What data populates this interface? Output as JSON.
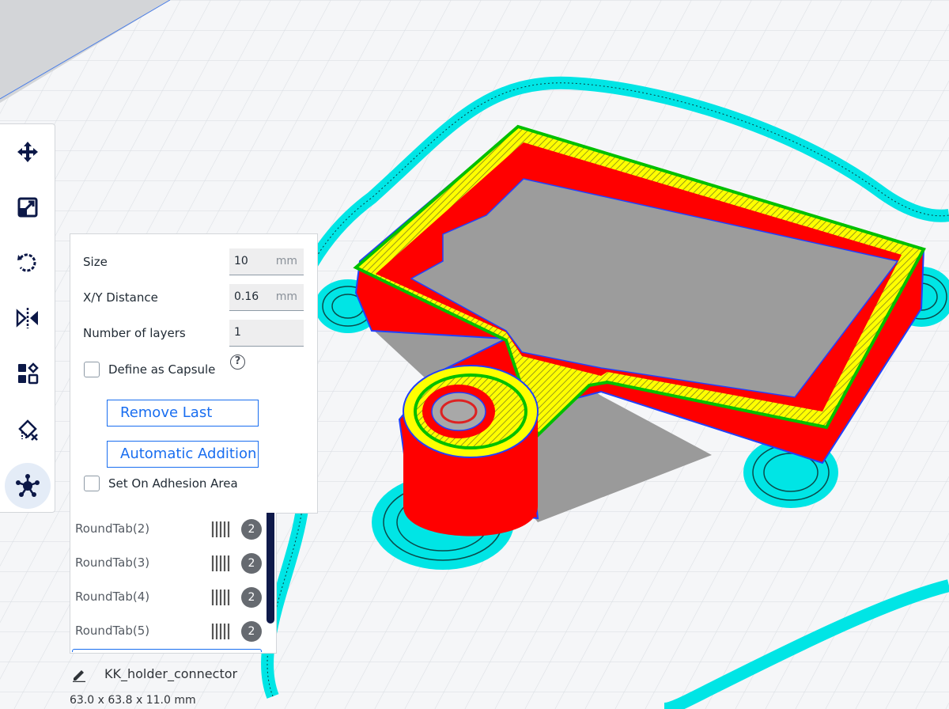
{
  "toolbar": {
    "tools": [
      {
        "name": "move-tool",
        "icon": "move-arrows-icon"
      },
      {
        "name": "scale-tool",
        "icon": "scale-icon"
      },
      {
        "name": "rotate-tool",
        "icon": "rotate-icon"
      },
      {
        "name": "mirror-tool",
        "icon": "mirror-icon"
      },
      {
        "name": "per-model-settings-tool",
        "icon": "per-model-settings-icon"
      },
      {
        "name": "support-blocker-tool",
        "icon": "support-blocker-icon"
      },
      {
        "name": "tab-anti-warping-tool",
        "icon": "tab-star-icon",
        "active": true
      }
    ]
  },
  "panel": {
    "size_label": "Size",
    "size_value": "10",
    "size_unit": "mm",
    "xy_label": "X/Y Distance",
    "xy_value": "0.16",
    "xy_unit": "mm",
    "layers_label": "Number of layers",
    "layers_value": "1",
    "capsule_label": "Define as Capsule",
    "capsule_checked": false,
    "remove_last_label": "Remove Last",
    "auto_add_label": "Automatic Addition",
    "adhesion_label": "Set On Adhesion Area",
    "adhesion_checked": false
  },
  "object_list": [
    {
      "name": "RoundTab(2)",
      "count": "2"
    },
    {
      "name": "RoundTab(3)",
      "count": "2"
    },
    {
      "name": "RoundTab(4)",
      "count": "2"
    },
    {
      "name": "RoundTab(5)",
      "count": "2"
    }
  ],
  "object": {
    "name": "KK_holder_connector",
    "dimensions": "63.0 x 63.8 x 11.0 mm"
  },
  "colors": {
    "accent": "#196ef0",
    "wall_red": "#ff0000",
    "infill_yellow": "#ffff00",
    "inner_green": "#00ff00",
    "skirt_cyan": "#00ffff",
    "shell_blue": "#3050ff",
    "support_gray": "#a0a0a0"
  }
}
